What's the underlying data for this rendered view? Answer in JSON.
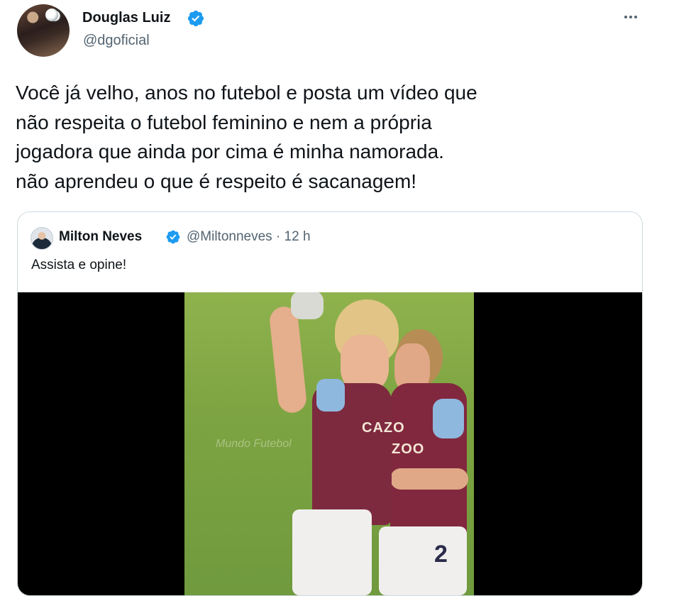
{
  "tweet": {
    "author_name": "Douglas Luiz",
    "handle": "@dgoficial",
    "text": "Você já velho, anos no futebol e posta um vídeo que\nnão respeita o futebol feminino e nem a própria\njogadora que ainda por cima é minha namorada.\n não aprendeu o que é respeito é sacanagem!",
    "more_icon": "more-horizontal-icon",
    "verified_icon": "verified-badge-icon"
  },
  "quote": {
    "author_name": "Milton Neves",
    "handle_time": "@Miltonneves · 12 h",
    "text": "Assista e opine!",
    "media": {
      "watermark": "Mundo Futebol",
      "shirt_sponsor_line1": "CAZO",
      "shirt_sponsor_line2": "ZOO",
      "shirt_number": "2"
    }
  },
  "colors": {
    "text_primary": "#0f1419",
    "text_secondary": "#536471",
    "border": "#cfd9de",
    "verified": "#1d9bf0"
  }
}
